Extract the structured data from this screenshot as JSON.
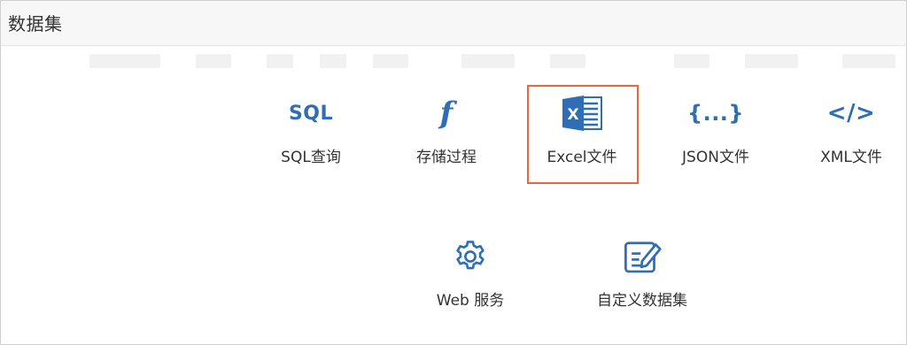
{
  "header": {
    "title": "数据集"
  },
  "options": [
    {
      "icon": "sql-icon",
      "icon_text": "SQL",
      "label": "SQL查询"
    },
    {
      "icon": "function-icon",
      "icon_text": "f",
      "label": "存储过程"
    },
    {
      "icon": "excel-icon",
      "label": "Excel文件",
      "selected": true
    },
    {
      "icon": "json-icon",
      "icon_text": "{...}",
      "label": "JSON文件"
    },
    {
      "icon": "xml-icon",
      "icon_text": "</>",
      "label": "XML文件"
    },
    {
      "icon": "gear-icon",
      "label": "Web 服务"
    },
    {
      "icon": "edit-form-icon",
      "label": "自定义数据集"
    }
  ],
  "colors": {
    "accent": "#2f6db5",
    "selection": "#e8673c",
    "text": "#333333"
  }
}
